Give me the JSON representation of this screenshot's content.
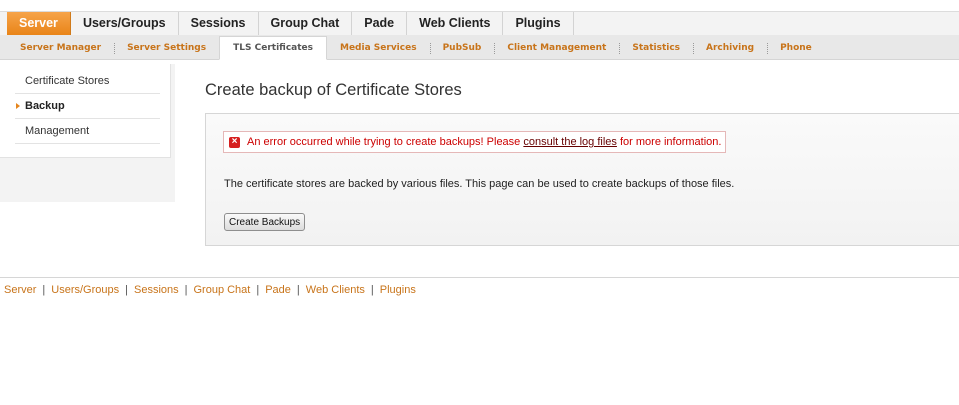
{
  "main_tabs": [
    "Server",
    "Users/Groups",
    "Sessions",
    "Group Chat",
    "Pade",
    "Web Clients",
    "Plugins"
  ],
  "sub_tabs": [
    "Server Manager",
    "Server Settings",
    "TLS Certificates",
    "Media Services",
    "PubSub",
    "Client Management",
    "Statistics",
    "Archiving",
    "Phone"
  ],
  "sidebar": {
    "items": [
      "Certificate Stores",
      "Backup",
      "Management"
    ]
  },
  "page": {
    "title": "Create backup of Certificate Stores",
    "error": {
      "before": "An error occurred while trying to create backups! Please ",
      "link": "consult the log files",
      "after": " for more information."
    },
    "description": "The certificate stores are backed by various files. This page can be used to create backups of those files.",
    "button_label": "Create Backups"
  },
  "footer": {
    "links": [
      "Server",
      "Users/Groups",
      "Sessions",
      "Group Chat",
      "Pade",
      "Web Clients",
      "Plugins"
    ],
    "separator": "|"
  },
  "colors": {
    "accent": "#e98418",
    "sub_tab_text": "#c8741a",
    "error_text": "#cc0000"
  }
}
